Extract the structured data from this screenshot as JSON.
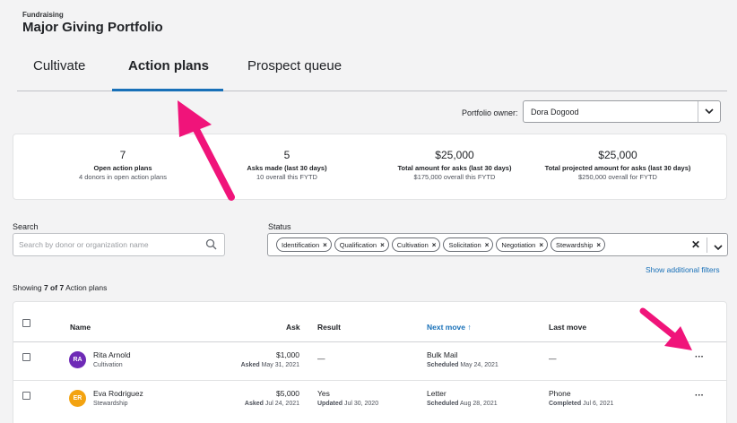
{
  "header": {
    "breadcrumb": "Fundraising",
    "title": "Major Giving Portfolio"
  },
  "tabs": [
    {
      "label": "Cultivate",
      "active": false
    },
    {
      "label": "Action plans",
      "active": true
    },
    {
      "label": "Prospect queue",
      "active": false
    }
  ],
  "owner": {
    "label": "Portfolio owner:",
    "value": "Dora Dogood"
  },
  "summary": [
    {
      "value": "7",
      "label": "Open action plans",
      "sub": "4 donors in open action plans"
    },
    {
      "value": "5",
      "label": "Asks made (last 30 days)",
      "sub": "10 overall this FYTD"
    },
    {
      "value": "$25,000",
      "label": "Total amount for asks (last 30 days)",
      "sub": "$175,000 overall this FYTD"
    },
    {
      "value": "$25,000",
      "label": "Total projected amount for asks (last 30 days)",
      "sub": "$250,000 overall for FYTD"
    }
  ],
  "filters": {
    "search_label": "Search",
    "search_placeholder": "Search by donor or organization name",
    "status_label": "Status",
    "status_chips": [
      "Identification",
      "Qualification",
      "Cultivation",
      "Solicitation",
      "Negotiation",
      "Stewardship"
    ],
    "additional_link": "Show additional filters"
  },
  "results": {
    "prefix": "Showing ",
    "count": "7 of 7",
    "suffix": " Action plans"
  },
  "table": {
    "columns": {
      "name": "Name",
      "ask": "Ask",
      "result": "Result",
      "next_move": "Next move ↑",
      "last_move": "Last move"
    },
    "rows": [
      {
        "initials": "RA",
        "avatar_color": "#6e2ab6",
        "name": "Rita Arnold",
        "stage": "Cultivation",
        "ask_amount": "$1,000",
        "ask_label": "Asked",
        "ask_date": " May 31, 2021",
        "result": "—",
        "result_label": "",
        "result_date": "",
        "next_move": "Bulk Mail",
        "next_label": "Scheduled",
        "next_date": " May 24, 2021",
        "last_move": "—",
        "last_label": "",
        "last_date": ""
      },
      {
        "initials": "ER",
        "avatar_color": "#f3a311",
        "name": "Eva Rodriguez",
        "stage": "Stewardship",
        "ask_amount": "$5,000",
        "ask_label": "Asked",
        "ask_date": " Jul 24, 2021",
        "result": "Yes",
        "result_label": "Updated",
        "result_date": " Jul 30, 2020",
        "next_move": "Letter",
        "next_label": "Scheduled",
        "next_date": " Aug 28, 2021",
        "last_move": "Phone",
        "last_label": "Completed",
        "last_date": " Jul 6, 2021"
      }
    ],
    "more_label": "···"
  },
  "colors": {
    "accent": "#1870b8",
    "annotation_arrow": "#f0147a"
  }
}
